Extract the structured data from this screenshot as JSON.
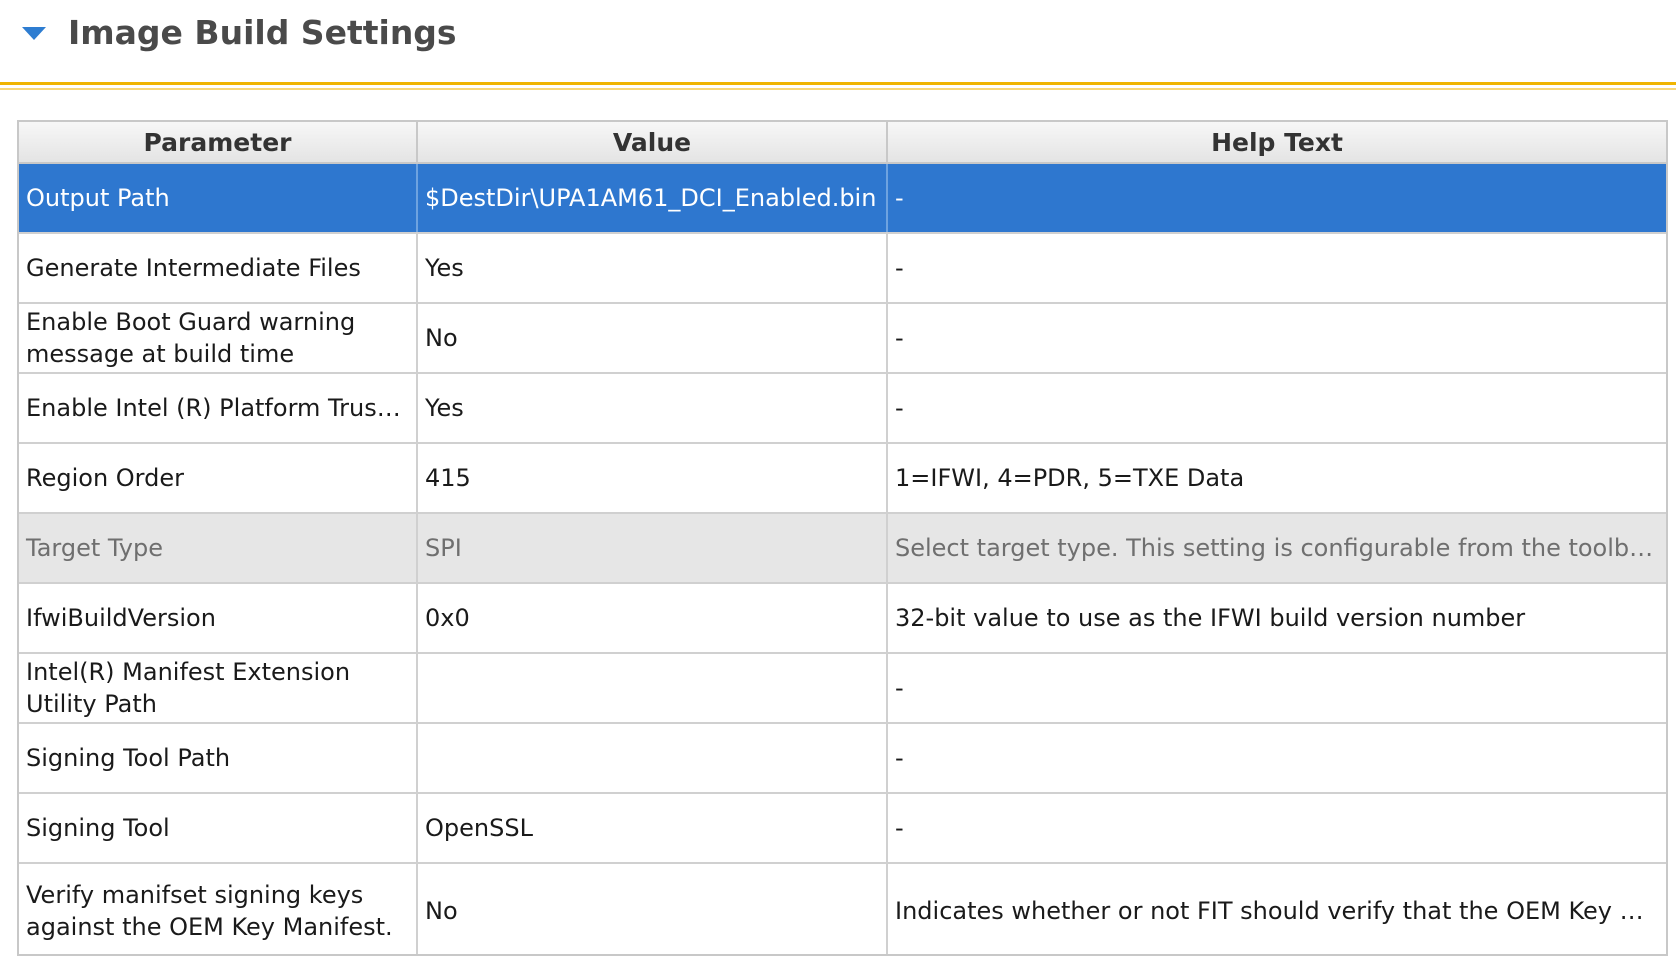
{
  "section": {
    "title": "Image Build Settings",
    "collapse_icon": "triangle-down-icon",
    "accent_color": "#f0b400"
  },
  "table": {
    "columns": [
      "Parameter",
      "Value",
      "Help Text"
    ],
    "rows": [
      {
        "parameter": "Output Path",
        "value": "$DestDir\\UPA1AM61_DCI_Enabled.bin",
        "help": "-",
        "state": "selected"
      },
      {
        "parameter": "Generate Intermediate Files",
        "value": "Yes",
        "help": "-",
        "state": "normal"
      },
      {
        "parameter": "Enable Boot Guard warning message at build time",
        "value": "No",
        "help": "-",
        "state": "normal"
      },
      {
        "parameter": "Enable Intel (R) Platform Trust ...",
        "value": "Yes",
        "help": "-",
        "state": "normal"
      },
      {
        "parameter": "Region Order",
        "value": "415",
        "help": "1=IFWI, 4=PDR, 5=TXE Data",
        "state": "normal"
      },
      {
        "parameter": "Target Type",
        "value": "SPI",
        "help": "Select target type. This setting is configurable from the toolbar.",
        "state": "disabled"
      },
      {
        "parameter": "IfwiBuildVersion",
        "value": "0x0",
        "help": "32-bit value to use as the IFWI build version number",
        "state": "normal"
      },
      {
        "parameter": "Intel(R) Manifest Extension Utility Path",
        "value": "",
        "help": "-",
        "state": "normal"
      },
      {
        "parameter": "Signing Tool Path",
        "value": "",
        "help": "-",
        "state": "normal"
      },
      {
        "parameter": "Signing Tool",
        "value": "OpenSSL",
        "help": "-",
        "state": "normal"
      },
      {
        "parameter": "Verify manifset signing keys against the OEM Key Manifest.",
        "value": "No",
        "help": "Indicates whether or not FIT should verify that the OEM Key Man...",
        "state": "normal"
      }
    ],
    "colors": {
      "selected_bg": "#2e77cf",
      "disabled_bg": "#e6e6e6"
    }
  }
}
